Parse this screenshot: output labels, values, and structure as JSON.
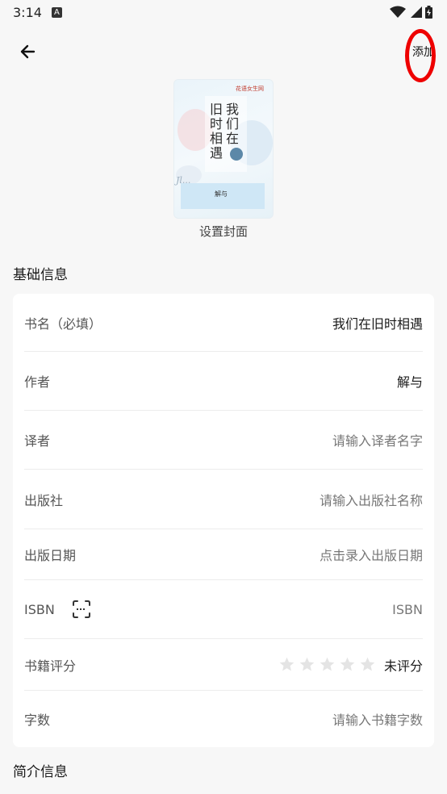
{
  "status": {
    "time": "3:14",
    "badge": "A"
  },
  "header": {
    "action_label": "添加"
  },
  "cover": {
    "publisher_tag": "花语女生网",
    "title_right": "我们在",
    "title_left": "旧时相遇",
    "author_small": "解与",
    "set_label": "设置封面"
  },
  "basic_section": {
    "title": "基础信息"
  },
  "fields": {
    "title": {
      "label": "书名（必填）",
      "value": "我们在旧时相遇"
    },
    "author": {
      "label": "作者",
      "value": "解与"
    },
    "translator": {
      "label": "译者",
      "placeholder": "请输入译者名字"
    },
    "publisher": {
      "label": "出版社",
      "placeholder": "请输入出版社名称"
    },
    "publish_date": {
      "label": "出版日期",
      "placeholder": "点击录入出版日期"
    },
    "isbn": {
      "label": "ISBN",
      "placeholder": "ISBN"
    },
    "rating": {
      "label": "书籍评分",
      "value_text": "未评分",
      "stars_filled": 0,
      "stars_total": 5
    },
    "word_count": {
      "label": "字数",
      "placeholder": "请输入书籍字数"
    }
  },
  "intro_section": {
    "title": "简介信息"
  },
  "colors": {
    "accent_red": "#ee0000",
    "star_empty": "#e4e4e4"
  }
}
